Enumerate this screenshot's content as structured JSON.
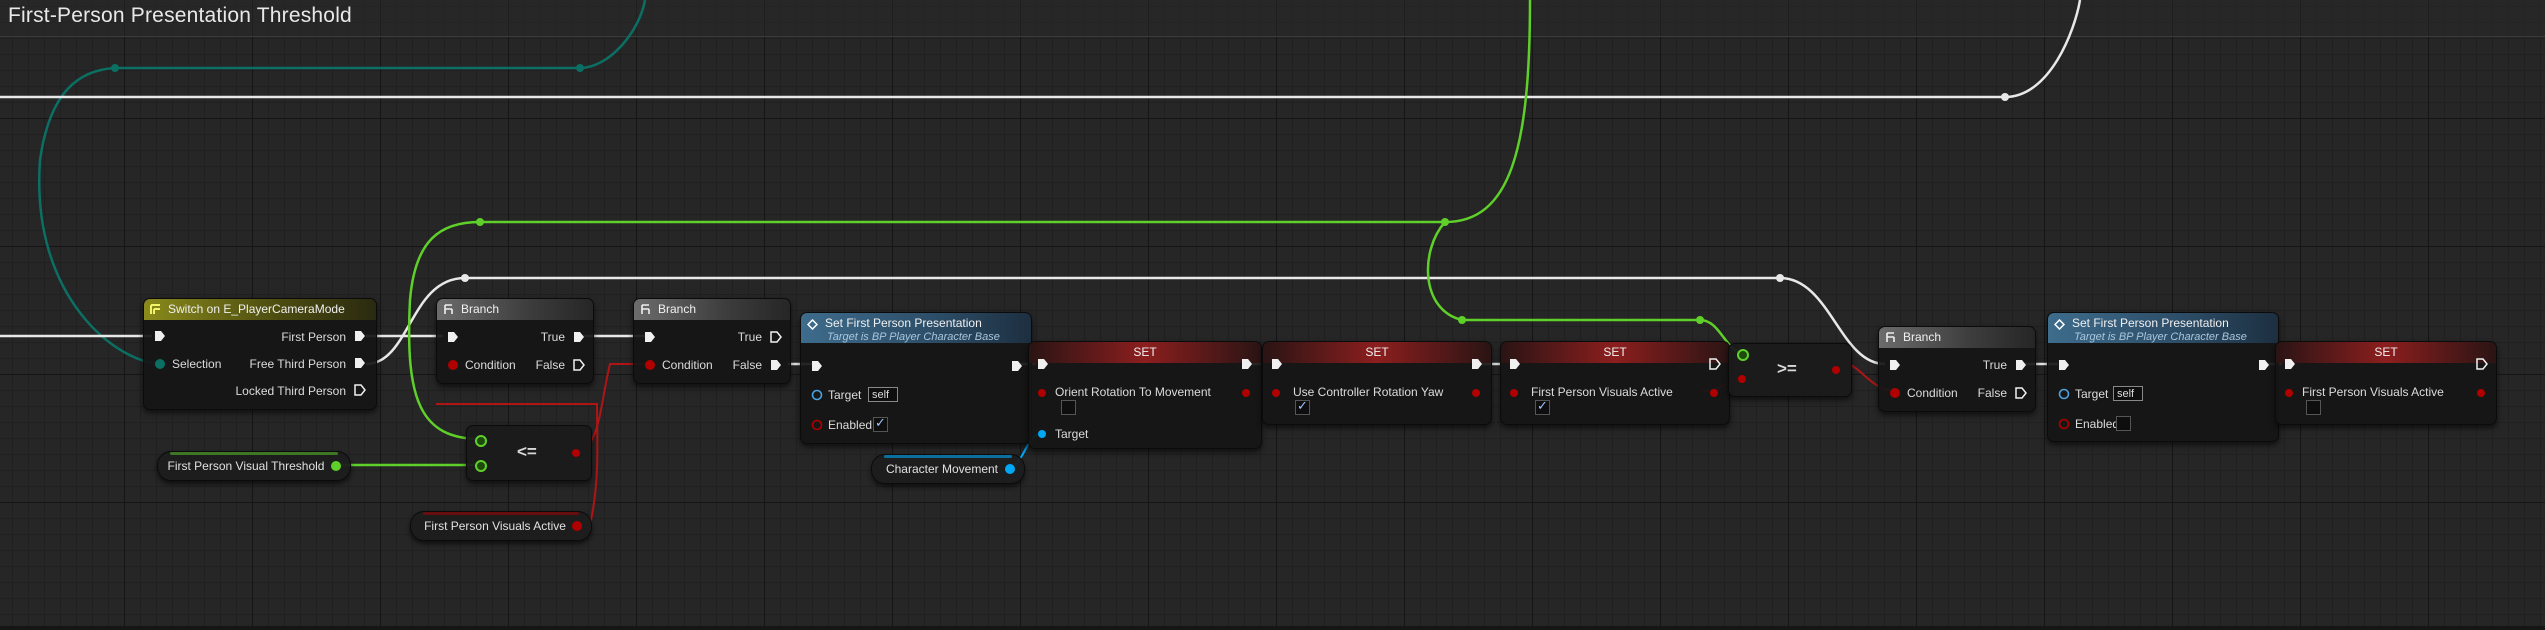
{
  "graph": {
    "title": "First-Person Presentation Threshold"
  },
  "colors": {
    "exec": "#ffffff",
    "float": "#7fe33a",
    "bool": "#c00000",
    "object": "#00a8f4",
    "enum": "#0c6f63"
  },
  "nodes": {
    "switch": {
      "title": "Switch on E_PlayerCameraMode",
      "selection": "Selection",
      "first_person": "First Person",
      "free_third_person": "Free Third Person",
      "locked_third_person": "Locked Third Person"
    },
    "branch1": {
      "title": "Branch",
      "condition": "Condition",
      "true_label": "True",
      "false_label": "False"
    },
    "branch2": {
      "title": "Branch",
      "condition": "Condition",
      "true_label": "True",
      "false_label": "False"
    },
    "branch3": {
      "title": "Branch",
      "condition": "Condition",
      "true_label": "True",
      "false_label": "False"
    },
    "compare_le": {
      "op": "<="
    },
    "compare_ge": {
      "op": ">="
    },
    "set_presentation1": {
      "title": "Set First Person Presentation",
      "subtitle": "Target is BP Player Character Base",
      "target": "Target",
      "target_value": "self",
      "enabled": "Enabled",
      "enabled_checked": true
    },
    "set_presentation2": {
      "title": "Set First Person Presentation",
      "subtitle": "Target is BP Player Character Base",
      "target": "Target",
      "target_value": "self",
      "enabled": "Enabled",
      "enabled_checked": false
    },
    "set_orient": {
      "title": "SET",
      "property": "Orient Rotation To Movement",
      "target": "Target",
      "checked": false
    },
    "set_yaw": {
      "title": "SET",
      "property": "Use Controller Rotation Yaw",
      "checked": true
    },
    "set_visuals1": {
      "title": "SET",
      "property": "First Person Visuals Active",
      "checked": true
    },
    "set_visuals2": {
      "title": "SET",
      "property": "First Person Visuals Active",
      "checked": false
    }
  },
  "variables": {
    "threshold": "First Person Visual Threshold",
    "visuals_active": "First Person Visuals Active",
    "char_movement": "Character Movement"
  }
}
